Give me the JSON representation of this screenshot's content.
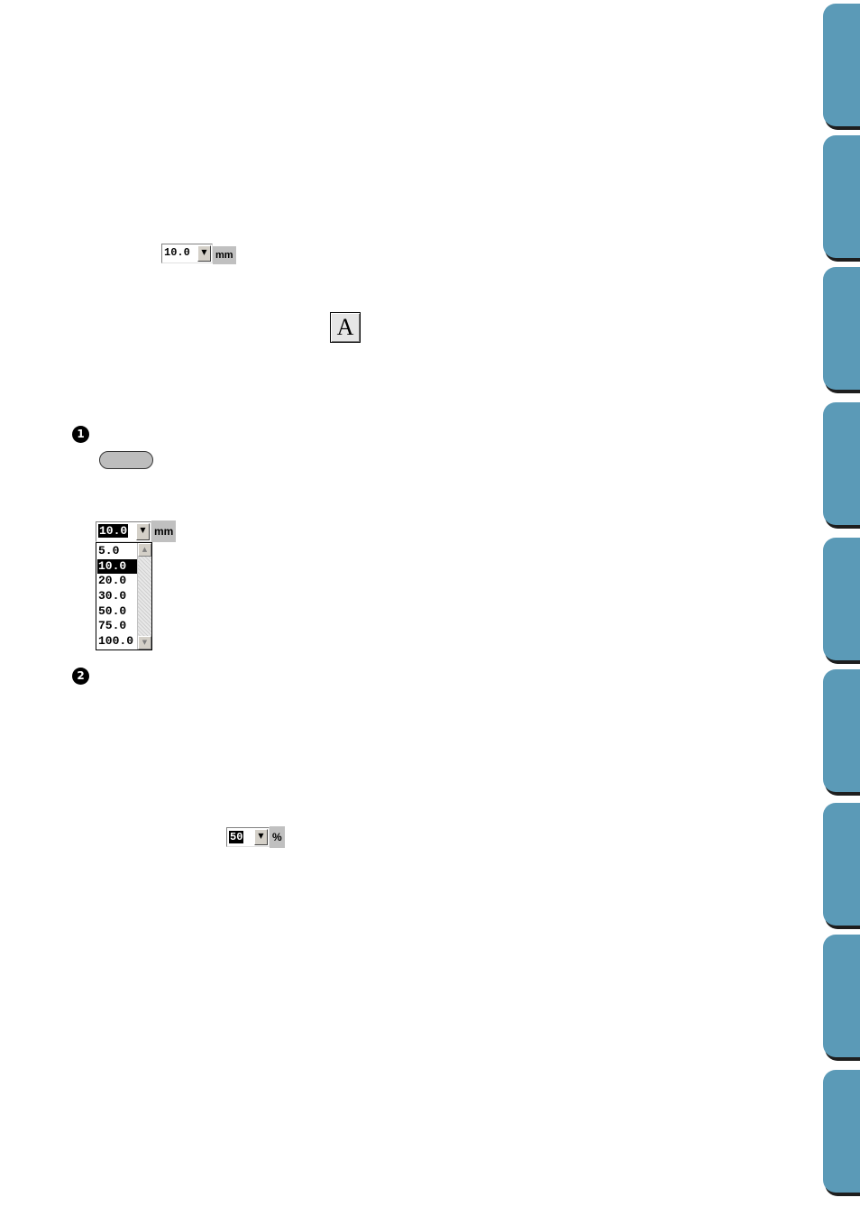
{
  "size_combo_top": {
    "value": "10.0",
    "arrow": "▼",
    "unit": "mm"
  },
  "text_tool_button": {
    "label": "A"
  },
  "steps": [
    "1",
    "2"
  ],
  "size_combo_open": {
    "value": "10.0",
    "arrow": "▼",
    "unit": "mm",
    "options": [
      "5.0",
      "10.0",
      "20.0",
      "30.0",
      "50.0",
      "75.0",
      "100.0"
    ],
    "selected_index": 1,
    "scroll_up": "▲",
    "scroll_down": "▼"
  },
  "percent_combo": {
    "value": "50",
    "arrow": "▼",
    "unit": "%"
  },
  "icons": {
    "dropdown": "chevron-down-icon",
    "text_tool": "text-tool-icon",
    "scroll_up": "scroll-up-icon",
    "scroll_down": "scroll-down-icon"
  },
  "colors": {
    "tab": "#5b9ab7",
    "tab_shadow": "#1e1e1e",
    "selection": "#000000"
  }
}
